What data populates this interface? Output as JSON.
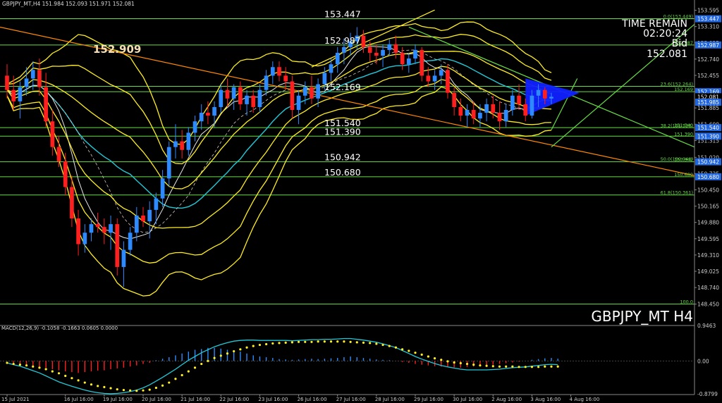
{
  "header": {
    "info": "GBPJPY_MT,H4  151.984 152.093 151.971 152.081"
  },
  "watermark": "GBPJPY_MT H4",
  "info_panel": {
    "line1": "TIME REMAIN",
    "line2": "02:20:24",
    "line3": "Bid",
    "line4": "152.081"
  },
  "macd_label": "MACD(12,26,9) -0.1058 -0.1663 0.0605 0.0000",
  "colors": {
    "bull": "#2e8bff",
    "bear": "#ff1f1f",
    "level": "#66dd44",
    "band": "#ffee22",
    "ma_cyan": "#22c8d8",
    "ma_white": "#e8e8e8",
    "ma_dash": "#d8c8c0",
    "trend_orange": "#ff8800",
    "triangle": "#1020ff",
    "label_bg": "#2266dd",
    "grid_text": "#cccccc"
  },
  "chart_data": {
    "type": "candlestick",
    "symbol": "GBPJPY_MT",
    "timeframe": "H4",
    "ylim": [
      148.1,
      153.75
    ],
    "price_ticks": [
      "153.595",
      "153.310",
      "153.025",
      "152.740",
      "152.455",
      "152.170",
      "151.885",
      "151.600",
      "151.315",
      "151.020",
      "150.735",
      "150.450",
      "150.165",
      "149.880",
      "149.595",
      "149.310",
      "149.025",
      "148.740",
      "148.450"
    ],
    "x_labels": [
      {
        "idx": 0,
        "label": "15 Jul 2021"
      },
      {
        "idx": 9,
        "label": "16 Jul 16:00"
      },
      {
        "idx": 15,
        "label": "19 Jul 16:00"
      },
      {
        "idx": 21,
        "label": "20 Jul 16:00"
      },
      {
        "idx": 27,
        "label": "21 Jul 16:00"
      },
      {
        "idx": 33,
        "label": "22 Jul 16:00"
      },
      {
        "idx": 39,
        "label": "23 Jul 16:00"
      },
      {
        "idx": 45,
        "label": "26 Jul 16:00"
      },
      {
        "idx": 51,
        "label": "27 Jul 16:00"
      },
      {
        "idx": 57,
        "label": "28 Jul 16:00"
      },
      {
        "idx": 63,
        "label": "29 Jul 16:00"
      },
      {
        "idx": 69,
        "label": "30 Jul 16:00"
      },
      {
        "idx": 75,
        "label": "2 Aug 16:00"
      },
      {
        "idx": 81,
        "label": "3 Aug 16:00"
      },
      {
        "idx": 87,
        "label": "4 Aug 16:00"
      }
    ],
    "candles": [
      [
        152.45,
        152.65,
        152.05,
        152.2
      ],
      [
        152.2,
        152.45,
        151.85,
        152.0
      ],
      [
        152.0,
        152.35,
        151.7,
        152.25
      ],
      [
        152.25,
        152.6,
        152.1,
        152.4
      ],
      [
        152.4,
        152.7,
        152.2,
        152.55
      ],
      [
        152.55,
        152.75,
        152.1,
        152.25
      ],
      [
        152.25,
        152.5,
        151.55,
        151.65
      ],
      [
        151.65,
        151.85,
        151.05,
        151.2
      ],
      [
        151.2,
        151.4,
        150.85,
        150.95
      ],
      [
        150.95,
        151.1,
        150.35,
        150.5
      ],
      [
        150.5,
        150.7,
        149.8,
        149.95
      ],
      [
        149.95,
        150.1,
        149.3,
        149.5
      ],
      [
        149.5,
        149.85,
        149.35,
        149.7
      ],
      [
        149.7,
        149.95,
        149.55,
        149.85
      ],
      [
        149.85,
        150.05,
        149.7,
        149.8
      ],
      [
        149.8,
        149.95,
        149.5,
        149.7
      ],
      [
        149.7,
        150.0,
        149.4,
        149.85
      ],
      [
        149.85,
        149.95,
        148.95,
        149.1
      ],
      [
        149.1,
        149.55,
        148.75,
        149.4
      ],
      [
        149.4,
        149.8,
        149.3,
        149.7
      ],
      [
        149.7,
        150.15,
        149.55,
        150.0
      ],
      [
        150.0,
        150.15,
        149.8,
        149.9
      ],
      [
        149.9,
        150.25,
        149.6,
        150.1
      ],
      [
        150.1,
        150.4,
        149.85,
        150.3
      ],
      [
        150.3,
        150.8,
        150.15,
        150.65
      ],
      [
        150.65,
        151.3,
        150.5,
        151.2
      ],
      [
        151.2,
        151.6,
        151.0,
        151.3
      ],
      [
        151.3,
        151.5,
        151.0,
        151.15
      ],
      [
        151.15,
        151.55,
        151.05,
        151.45
      ],
      [
        151.45,
        151.75,
        151.3,
        151.65
      ],
      [
        151.65,
        151.95,
        151.5,
        151.8
      ],
      [
        151.8,
        152.0,
        151.6,
        151.75
      ],
      [
        151.75,
        152.0,
        151.55,
        151.9
      ],
      [
        151.9,
        152.3,
        151.8,
        152.2
      ],
      [
        152.2,
        152.4,
        151.9,
        152.05
      ],
      [
        152.05,
        152.3,
        151.85,
        152.25
      ],
      [
        152.25,
        152.35,
        151.85,
        151.95
      ],
      [
        151.95,
        152.2,
        151.75,
        152.1
      ],
      [
        152.1,
        152.2,
        151.8,
        151.9
      ],
      [
        151.9,
        152.3,
        151.8,
        152.2
      ],
      [
        152.2,
        152.55,
        152.1,
        152.45
      ],
      [
        152.45,
        152.7,
        152.3,
        152.6
      ],
      [
        152.6,
        152.7,
        152.35,
        152.45
      ],
      [
        152.45,
        152.6,
        152.2,
        152.35
      ],
      [
        152.35,
        152.45,
        151.7,
        151.85
      ],
      [
        151.85,
        152.2,
        151.6,
        152.1
      ],
      [
        152.1,
        152.35,
        151.95,
        152.25
      ],
      [
        152.25,
        152.45,
        151.95,
        152.05
      ],
      [
        152.05,
        152.4,
        151.9,
        152.3
      ],
      [
        152.3,
        152.6,
        152.2,
        152.5
      ],
      [
        152.5,
        152.75,
        152.35,
        152.65
      ],
      [
        152.65,
        152.95,
        152.5,
        152.85
      ],
      [
        152.85,
        153.1,
        152.65,
        152.95
      ],
      [
        152.95,
        153.2,
        152.8,
        153.05
      ],
      [
        153.05,
        153.3,
        152.9,
        153.15
      ],
      [
        153.15,
        153.25,
        152.85,
        152.95
      ],
      [
        152.95,
        153.05,
        152.7,
        152.85
      ],
      [
        152.85,
        153.0,
        152.65,
        152.8
      ],
      [
        152.8,
        153.0,
        152.6,
        152.9
      ],
      [
        152.9,
        153.1,
        152.8,
        153.0
      ],
      [
        153.0,
        153.15,
        152.75,
        152.85
      ],
      [
        152.85,
        152.95,
        152.55,
        152.65
      ],
      [
        152.65,
        152.85,
        152.5,
        152.75
      ],
      [
        152.75,
        153.0,
        152.65,
        152.9
      ],
      [
        152.9,
        152.95,
        152.35,
        152.45
      ],
      [
        152.45,
        152.6,
        152.25,
        152.35
      ],
      [
        152.35,
        152.55,
        152.2,
        152.45
      ],
      [
        152.45,
        152.65,
        152.3,
        152.55
      ],
      [
        152.55,
        152.65,
        152.05,
        152.15
      ],
      [
        152.15,
        152.25,
        151.75,
        151.9
      ],
      [
        151.9,
        152.05,
        151.65,
        151.75
      ],
      [
        151.75,
        151.95,
        151.55,
        151.85
      ],
      [
        151.85,
        152.0,
        151.6,
        151.7
      ],
      [
        151.7,
        151.95,
        151.55,
        151.8
      ],
      [
        151.8,
        152.05,
        151.65,
        151.95
      ],
      [
        151.95,
        152.1,
        151.7,
        151.8
      ],
      [
        151.8,
        152.0,
        151.5,
        151.65
      ],
      [
        151.65,
        151.95,
        151.55,
        151.85
      ],
      [
        151.85,
        152.2,
        151.75,
        152.1
      ],
      [
        152.1,
        152.3,
        151.85,
        151.95
      ],
      [
        151.95,
        152.05,
        151.65,
        151.75
      ],
      [
        151.75,
        152.2,
        151.7,
        152.1
      ],
      [
        152.1,
        152.3,
        151.9,
        152.2
      ],
      [
        152.2,
        152.25,
        151.95,
        152.05
      ],
      [
        152.05,
        152.15,
        151.95,
        152.08
      ]
    ],
    "levels": [
      {
        "price": 153.447,
        "label": "153.447",
        "tag": "0.0(153.449)"
      },
      {
        "price": 152.987,
        "label": "152.987",
        "tag": "152.987"
      },
      {
        "price": 152.264,
        "label": "",
        "tag": "23.6(152.264)"
      },
      {
        "price": 152.169,
        "label": "152.169",
        "tag": "152.169"
      },
      {
        "price": 151.54,
        "label": "151.540",
        "tag": "151.540"
      },
      {
        "price": 151.39,
        "label": "151.390",
        "tag": "151.390"
      },
      {
        "price": 150.942,
        "label": "150.942",
        "tag": "150.942"
      },
      {
        "price": 150.68,
        "label": "150.680",
        "tag": "150.680"
      },
      {
        "price": 150.361,
        "label": "",
        "tag": "61.8(150.361)"
      },
      {
        "price": 148.45,
        "label": "",
        "tag": "100.0"
      }
    ],
    "fib_tags": [
      {
        "price": 151.536,
        "tag": "38.2(151.536)"
      },
      {
        "price": 150.948,
        "tag": "50.0(150.948)"
      }
    ],
    "right_labels": [
      {
        "price": 152.169,
        "text": "152.169"
      },
      {
        "price": 152.081,
        "text": "152.081"
      },
      {
        "price": 151.985,
        "text": "151.985"
      }
    ],
    "left_price_label": {
      "price": 152.909,
      "text": "152.909"
    },
    "macd": {
      "ylim": [
        -0.9,
        0.95
      ],
      "ticks": [
        "0.9463",
        "0.00",
        "-0.8799"
      ],
      "histogram": [
        0.0,
        -0.05,
        -0.08,
        -0.1,
        -0.12,
        -0.15,
        -0.18,
        -0.22,
        -0.25,
        -0.28,
        -0.3,
        -0.32,
        -0.3,
        -0.28,
        -0.26,
        -0.25,
        -0.22,
        -0.2,
        -0.18,
        -0.15,
        -0.12,
        -0.08,
        -0.05,
        0.02,
        0.06,
        0.1,
        0.15,
        0.2,
        0.25,
        0.3,
        0.32,
        0.35,
        0.35,
        0.33,
        0.3,
        0.28,
        0.25,
        0.2,
        0.15,
        0.12,
        0.1,
        0.08,
        0.05,
        0.04,
        0.03,
        0.04,
        0.05,
        0.06,
        0.05,
        0.06,
        0.07,
        0.08,
        0.1,
        0.12,
        0.1,
        0.08,
        0.06,
        0.04,
        0.03,
        0.02,
        0.0,
        -0.03,
        -0.05,
        -0.08,
        -0.1,
        -0.12,
        -0.14,
        -0.15,
        -0.16,
        -0.17,
        -0.18,
        -0.16,
        -0.15,
        -0.13,
        -0.12,
        -0.1,
        -0.08,
        -0.06,
        -0.04,
        -0.02,
        0.0,
        0.03,
        0.05,
        0.07,
        0.08,
        0.06
      ],
      "signal": [
        -0.05,
        -0.08,
        -0.1,
        -0.12,
        -0.15,
        -0.18,
        -0.22,
        -0.28,
        -0.33,
        -0.4,
        -0.46,
        -0.52,
        -0.58,
        -0.63,
        -0.67,
        -0.7,
        -0.73,
        -0.76,
        -0.78,
        -0.79,
        -0.8,
        -0.79,
        -0.77,
        -0.72,
        -0.66,
        -0.58,
        -0.48,
        -0.38,
        -0.28,
        -0.18,
        -0.08,
        0.0,
        0.08,
        0.14,
        0.2,
        0.26,
        0.31,
        0.36,
        0.4,
        0.43,
        0.45,
        0.47,
        0.48,
        0.49,
        0.5,
        0.51,
        0.51,
        0.51,
        0.52,
        0.52,
        0.52,
        0.52,
        0.52,
        0.51,
        0.5,
        0.49,
        0.48,
        0.46,
        0.43,
        0.4,
        0.36,
        0.31,
        0.27,
        0.22,
        0.17,
        0.12,
        0.07,
        0.03,
        -0.01,
        -0.04,
        -0.06,
        -0.08,
        -0.1,
        -0.12,
        -0.13,
        -0.14,
        -0.15,
        -0.15,
        -0.15,
        -0.16,
        -0.16,
        -0.16,
        -0.16,
        -0.15,
        -0.15,
        -0.15
      ],
      "macd_line": [
        -0.05,
        -0.1,
        -0.14,
        -0.2,
        -0.26,
        -0.32,
        -0.4,
        -0.48,
        -0.56,
        -0.62,
        -0.68,
        -0.73,
        -0.78,
        -0.82,
        -0.85,
        -0.87,
        -0.88,
        -0.87,
        -0.85,
        -0.82,
        -0.78,
        -0.72,
        -0.64,
        -0.54,
        -0.44,
        -0.33,
        -0.22,
        -0.1,
        0.02,
        0.12,
        0.22,
        0.3,
        0.38,
        0.44,
        0.49,
        0.53,
        0.55,
        0.56,
        0.56,
        0.55,
        0.55,
        0.55,
        0.55,
        0.55,
        0.54,
        0.55,
        0.56,
        0.57,
        0.57,
        0.58,
        0.58,
        0.59,
        0.6,
        0.6,
        0.58,
        0.56,
        0.53,
        0.5,
        0.46,
        0.41,
        0.36,
        0.28,
        0.2,
        0.12,
        0.05,
        -0.01,
        -0.07,
        -0.12,
        -0.16,
        -0.19,
        -0.22,
        -0.24,
        -0.24,
        -0.24,
        -0.24,
        -0.23,
        -0.22,
        -0.2,
        -0.18,
        -0.17,
        -0.16,
        -0.14,
        -0.12,
        -0.1,
        -0.09,
        -0.1
      ]
    }
  }
}
